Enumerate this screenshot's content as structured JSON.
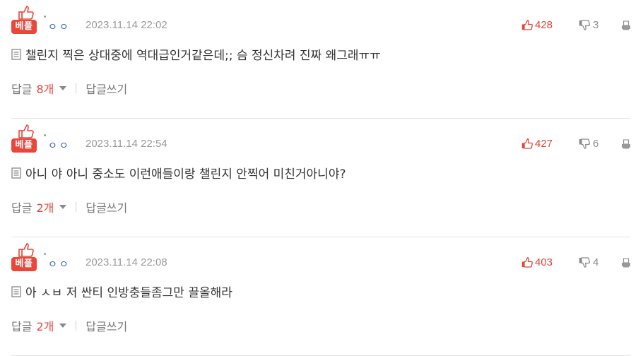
{
  "comments": [
    {
      "best_label": "베플",
      "nickname": "ㅇㅇ",
      "date": "2023.11.14 22:02",
      "up": "428",
      "down": "3",
      "text": "챌린지 찍은 상대중에 역대급인거같은데;; 슴 정신차려 진짜 왜그래ㅠㅠ",
      "reply_prefix": "답글",
      "reply_count": "8개",
      "write_label": "답글쓰기"
    },
    {
      "best_label": "베플",
      "nickname": "ㅇㅇ",
      "date": "2023.11.14 22:54",
      "up": "427",
      "down": "6",
      "text": "아니 야 아니 중소도 이런애들이랑 챌린지 안찍어 미친거아니야?",
      "reply_prefix": "답글",
      "reply_count": "2개",
      "write_label": "답글쓰기"
    },
    {
      "best_label": "베플",
      "nickname": "ㅇㅇ",
      "date": "2023.11.14 22:08",
      "up": "403",
      "down": "4",
      "text": "아 ㅅㅂ 저 싼티 인방충들좀그만 끌올해라",
      "reply_prefix": "답글",
      "reply_count": "2개",
      "write_label": "답글쓰기"
    }
  ],
  "icons": {
    "best": "thumbs-up-icon",
    "up": "thumbs-up-icon",
    "down": "thumbs-down-icon",
    "print": "printer-icon",
    "doc": "document-icon",
    "caret": "caret-down-icon"
  },
  "colors": {
    "best_badge": "#e8473a",
    "upvote": "#e0463a",
    "nickname": "#2c63b8"
  }
}
